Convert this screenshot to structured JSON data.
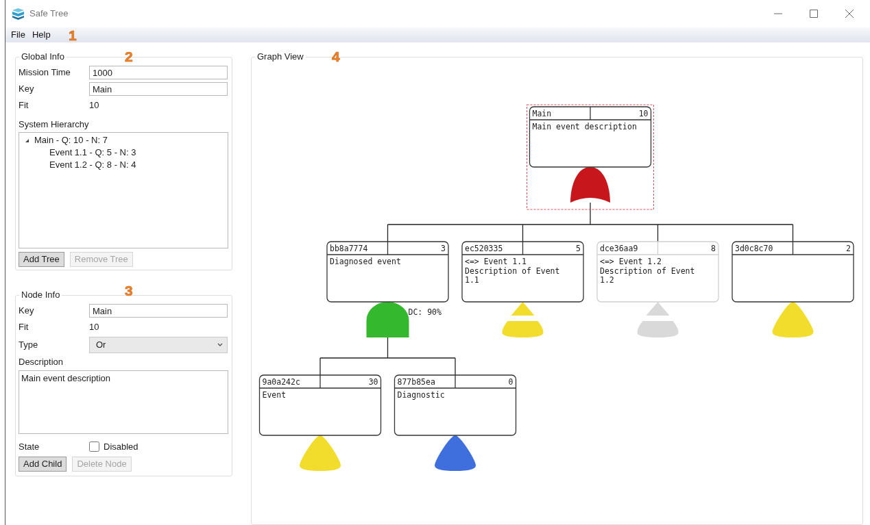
{
  "window": {
    "title": "Safe Tree"
  },
  "menu": {
    "items": [
      {
        "label": "File"
      },
      {
        "label": "Help"
      }
    ],
    "callout": "1"
  },
  "global_info": {
    "title": "Global Info",
    "callout": "2",
    "fields": [
      {
        "label": "Mission Time",
        "value": "1000",
        "kind": "input"
      },
      {
        "label": "Key",
        "value": "Main",
        "kind": "input"
      },
      {
        "label": "Fit",
        "value": "10",
        "kind": "text"
      }
    ],
    "hierarchy_label": "System Hierarchy",
    "hierarchy": [
      {
        "label": "Main - Q: 10 - N: 7",
        "expanded": true,
        "children": [
          {
            "label": "Event 1.1 - Q: 5 - N: 3"
          },
          {
            "label": "Event 1.2 - Q: 8 - N: 4"
          }
        ]
      }
    ],
    "buttons": [
      {
        "label": "Add Tree",
        "disabled": false
      },
      {
        "label": "Remove Tree",
        "disabled": true
      }
    ]
  },
  "node_info": {
    "title": "Node Info",
    "callout": "3",
    "fields": [
      {
        "label": "Key",
        "value": "Main",
        "kind": "input"
      },
      {
        "label": "Fit",
        "value": "10",
        "kind": "text"
      },
      {
        "label": "Type",
        "value": "Or",
        "kind": "select"
      },
      {
        "label": "Description",
        "value": "Main event description",
        "kind": "textarea"
      },
      {
        "label": "State",
        "value": "Disabled",
        "kind": "checkbox",
        "checked": false
      }
    ],
    "buttons": [
      {
        "label": "Add Child",
        "disabled": false
      },
      {
        "label": "Delete Node",
        "disabled": true
      }
    ]
  },
  "graph": {
    "title": "Graph View",
    "callout": "4",
    "root": {
      "key": "Main",
      "value": "10",
      "description": [
        "Main event description"
      ],
      "kind": "or",
      "color": "#c8161d",
      "selected": true,
      "disabled": false,
      "children": [
        {
          "key": "bb8a7774",
          "value": "3",
          "description": [
            "Diagnosed event"
          ],
          "kind": "and",
          "color": "#33b82e",
          "label": "DC: 90%",
          "selected": false,
          "disabled": false,
          "children": [
            {
              "key": "9a0a242c",
              "value": "30",
              "description": [
                "Event"
              ],
              "kind": "event",
              "color": "#f2dc2c",
              "selected": false,
              "disabled": false
            },
            {
              "key": "877b85ea",
              "value": "0",
              "description": [
                "Diagnostic"
              ],
              "kind": "event",
              "color": "#3e6fdc",
              "selected": false,
              "disabled": false
            }
          ]
        },
        {
          "key": "ec520335",
          "value": "5",
          "description": [
            "<=> Event 1.1",
            "Description of Event",
            "1.1"
          ],
          "kind": "split",
          "color": "#f2dc2c",
          "selected": false,
          "disabled": false
        },
        {
          "key": "dce36aa9",
          "value": "8",
          "description": [
            "<=> Event 1.2",
            "Description of Event",
            "1.2"
          ],
          "kind": "split",
          "color": "#d9d9d9",
          "selected": false,
          "disabled": true
        },
        {
          "key": "3d0c8c70",
          "value": "2",
          "kind": "event",
          "color": "#f2dc2c",
          "selected": false,
          "disabled": false
        }
      ]
    }
  }
}
